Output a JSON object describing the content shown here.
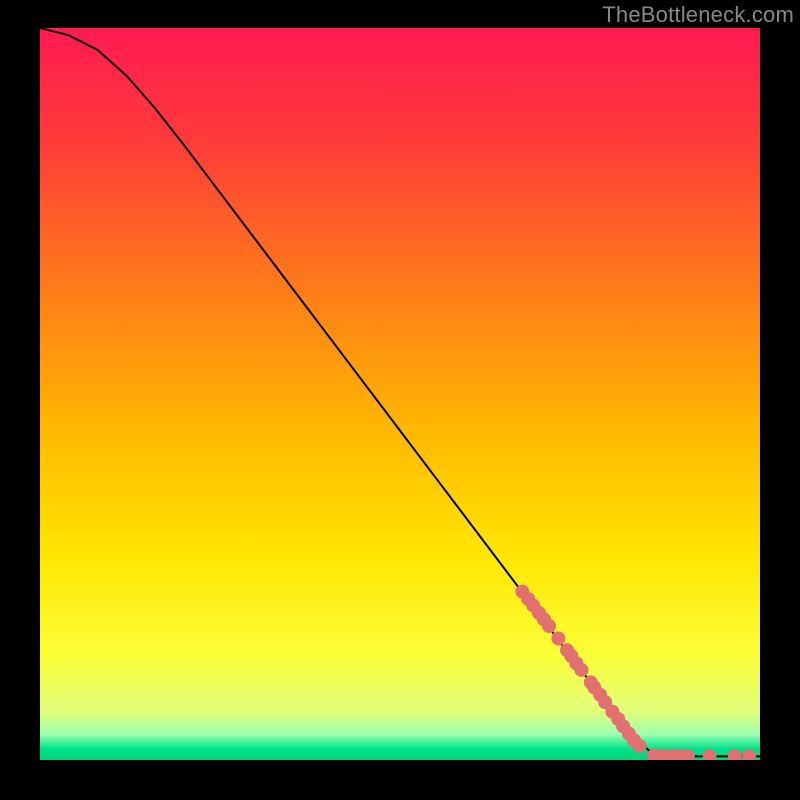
{
  "watermark": "TheBottleneck.com",
  "chart_data": {
    "type": "line",
    "title": "",
    "xlabel": "",
    "ylabel": "",
    "xlim": [
      0,
      100
    ],
    "ylim": [
      0,
      100
    ],
    "background_gradient_stops": [
      {
        "offset": 0.0,
        "color": "#ff1a52"
      },
      {
        "offset": 0.15,
        "color": "#ff3a3a"
      },
      {
        "offset": 0.35,
        "color": "#ff7a1a"
      },
      {
        "offset": 0.55,
        "color": "#ffb800"
      },
      {
        "offset": 0.72,
        "color": "#ffe600"
      },
      {
        "offset": 0.86,
        "color": "#fbff3a"
      },
      {
        "offset": 0.935,
        "color": "#e0ff7a"
      },
      {
        "offset": 0.965,
        "color": "#9cffb0"
      },
      {
        "offset": 0.985,
        "color": "#00e28a"
      },
      {
        "offset": 1.0,
        "color": "#00d47a"
      }
    ],
    "curve": [
      {
        "x": 0,
        "y": 100.0
      },
      {
        "x": 4,
        "y": 99.0
      },
      {
        "x": 8,
        "y": 97.0
      },
      {
        "x": 12,
        "y": 93.5
      },
      {
        "x": 16,
        "y": 89.0
      },
      {
        "x": 20,
        "y": 84.0
      },
      {
        "x": 25,
        "y": 77.5
      },
      {
        "x": 30,
        "y": 71.0
      },
      {
        "x": 35,
        "y": 64.5
      },
      {
        "x": 40,
        "y": 58.0
      },
      {
        "x": 45,
        "y": 51.5
      },
      {
        "x": 50,
        "y": 45.0
      },
      {
        "x": 55,
        "y": 38.5
      },
      {
        "x": 60,
        "y": 32.0
      },
      {
        "x": 65,
        "y": 25.5
      },
      {
        "x": 70,
        "y": 19.0
      },
      {
        "x": 75,
        "y": 12.5
      },
      {
        "x": 80,
        "y": 6.0
      },
      {
        "x": 83,
        "y": 2.5
      },
      {
        "x": 85,
        "y": 1.0
      },
      {
        "x": 88,
        "y": 0.5
      },
      {
        "x": 92,
        "y": 0.5
      },
      {
        "x": 96,
        "y": 0.5
      },
      {
        "x": 100,
        "y": 0.5
      }
    ],
    "markers": [
      {
        "x": 67.0,
        "y": 23.0
      },
      {
        "x": 67.8,
        "y": 22.0
      },
      {
        "x": 68.5,
        "y": 21.1
      },
      {
        "x": 69.3,
        "y": 20.1
      },
      {
        "x": 70.0,
        "y": 19.2
      },
      {
        "x": 70.7,
        "y": 18.3
      },
      {
        "x": 72.0,
        "y": 16.6
      },
      {
        "x": 73.2,
        "y": 15.0
      },
      {
        "x": 73.8,
        "y": 14.2
      },
      {
        "x": 74.5,
        "y": 13.2
      },
      {
        "x": 75.2,
        "y": 12.3
      },
      {
        "x": 76.5,
        "y": 10.6
      },
      {
        "x": 77.0,
        "y": 9.9
      },
      {
        "x": 77.8,
        "y": 8.9
      },
      {
        "x": 78.5,
        "y": 7.9
      },
      {
        "x": 79.5,
        "y": 6.6
      },
      {
        "x": 80.3,
        "y": 5.6
      },
      {
        "x": 81.0,
        "y": 4.6
      },
      {
        "x": 81.8,
        "y": 3.6
      },
      {
        "x": 82.5,
        "y": 2.7
      },
      {
        "x": 83.3,
        "y": 1.9
      },
      {
        "x": 85.3,
        "y": 0.6
      },
      {
        "x": 86.2,
        "y": 0.5
      },
      {
        "x": 87.1,
        "y": 0.5
      },
      {
        "x": 88.1,
        "y": 0.5
      },
      {
        "x": 89.0,
        "y": 0.5
      },
      {
        "x": 90.0,
        "y": 0.5
      },
      {
        "x": 93.0,
        "y": 0.5
      },
      {
        "x": 96.5,
        "y": 0.5
      },
      {
        "x": 98.5,
        "y": 0.5
      }
    ],
    "marker_color": "#e27070",
    "curve_color": "#000000"
  }
}
